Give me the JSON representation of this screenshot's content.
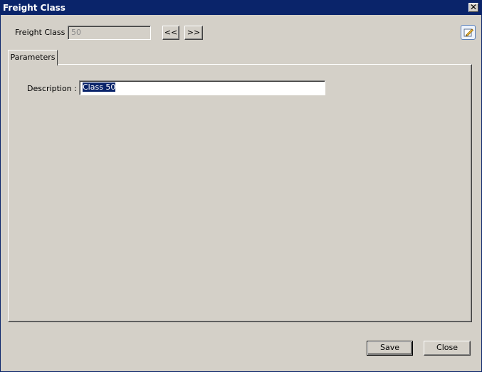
{
  "window": {
    "title": "Freight Class",
    "close_glyph": "✕"
  },
  "header": {
    "freight_class_label": "Freight Class :",
    "freight_class_value": "50",
    "prev_label": "<<",
    "next_label": ">>",
    "edit_icon": "edit-pencil-icon"
  },
  "tabs": [
    {
      "label": "Parameters",
      "active": true
    }
  ],
  "parameters": {
    "description_label": "Description :",
    "description_value": "Class 50"
  },
  "footer": {
    "save_label": "Save",
    "close_label": "Close"
  },
  "colors": {
    "titlebar": "#0a246a",
    "face": "#d4d0c8",
    "selection": "#0a246a"
  }
}
